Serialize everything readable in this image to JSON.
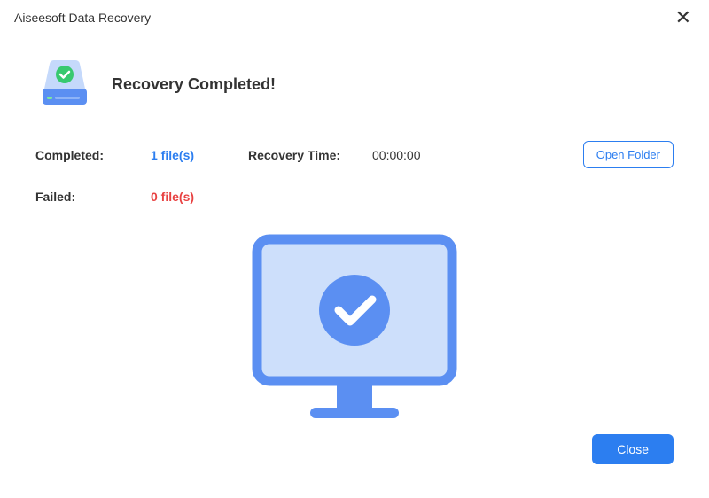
{
  "window": {
    "title": "Aiseesoft Data Recovery"
  },
  "heading": "Recovery Completed!",
  "stats": {
    "completed_label": "Completed:",
    "completed_value": "1 file(s)",
    "recovery_time_label": "Recovery Time:",
    "recovery_time_value": "00:00:00",
    "failed_label": "Failed:",
    "failed_value": "0 file(s)"
  },
  "buttons": {
    "open_folder": "Open Folder",
    "close": "Close"
  },
  "colors": {
    "accent": "#2c7ef0",
    "success": "#37c96f",
    "error": "#e84242"
  }
}
